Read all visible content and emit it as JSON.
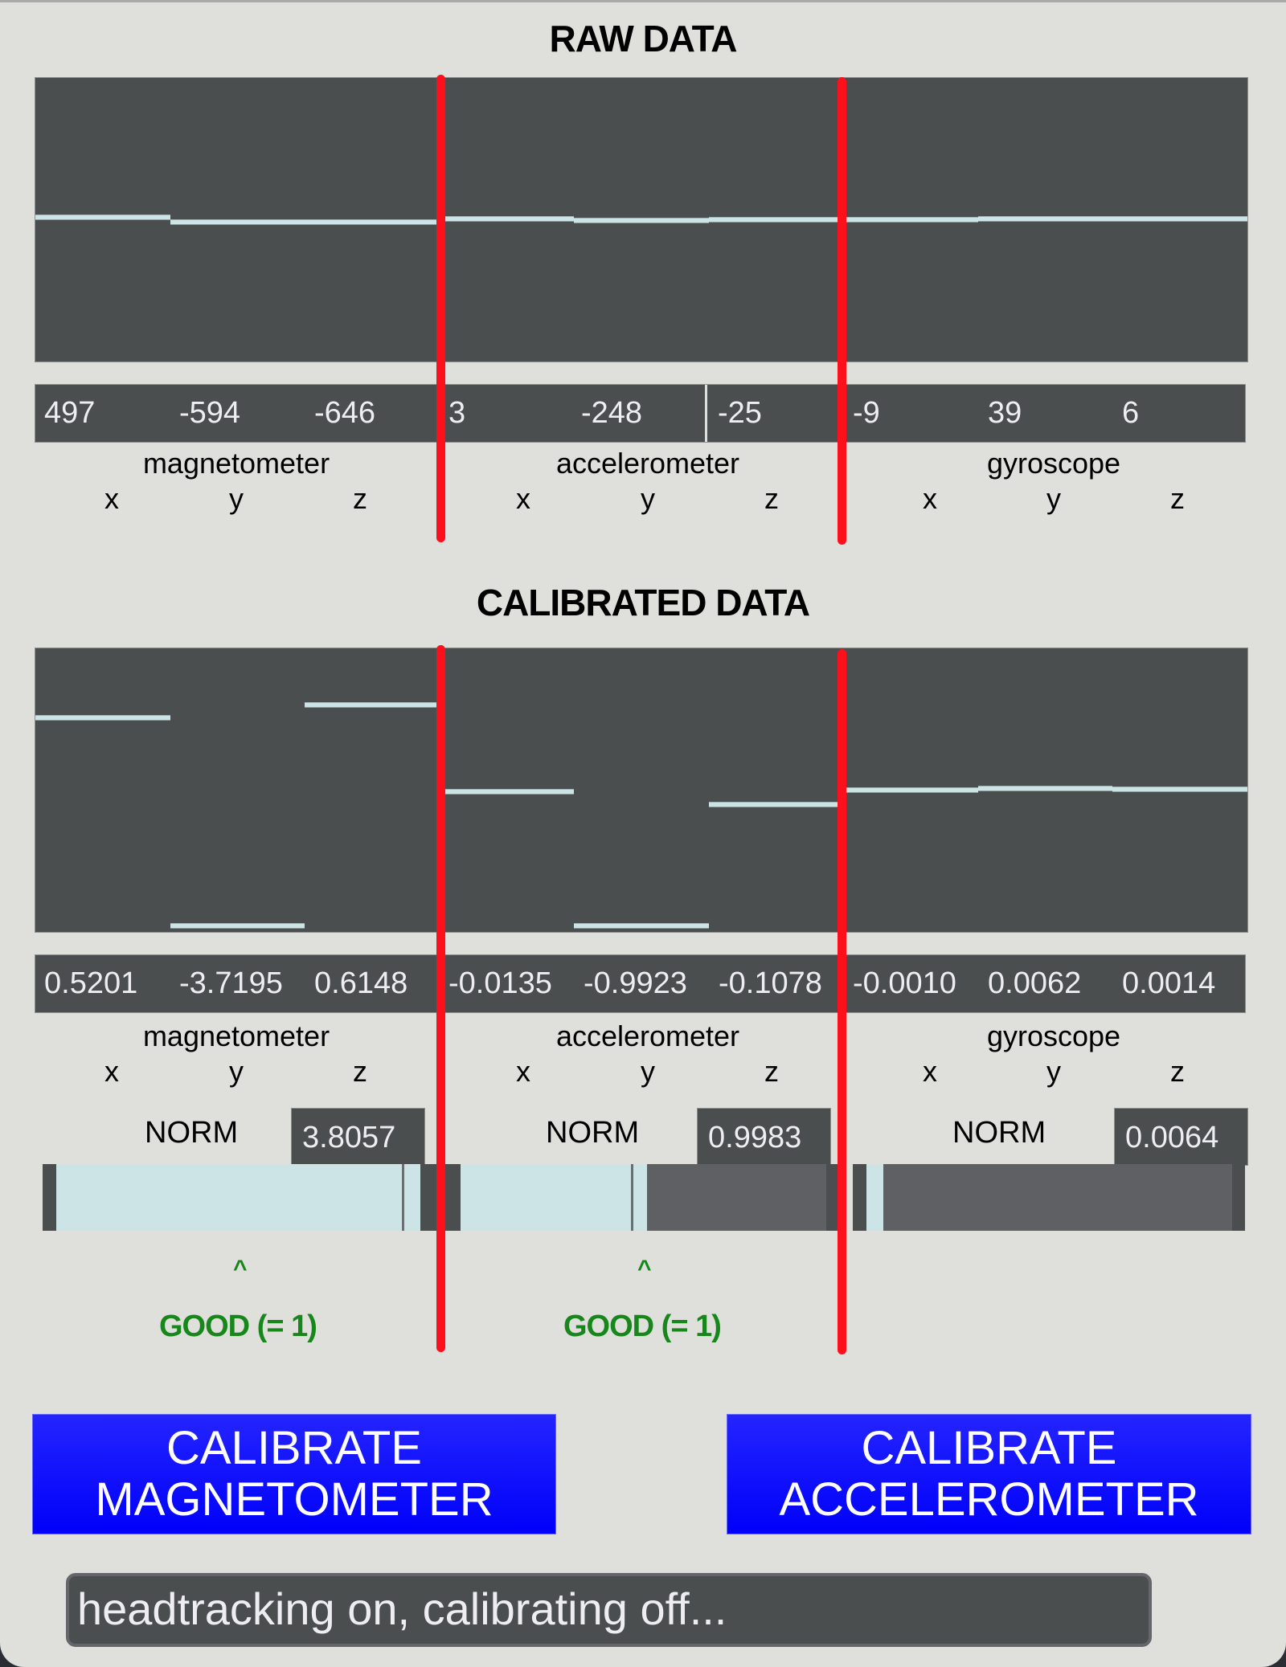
{
  "raw": {
    "title": "RAW DATA",
    "y_range": [
      -32768,
      32768
    ],
    "values": {
      "magnetometer": [
        "497",
        "-594",
        "-646"
      ],
      "accelerometer": [
        "3",
        "-248",
        "-25"
      ],
      "gyroscope": [
        "-9",
        "39",
        "6"
      ]
    },
    "plot_values": [
      497,
      -594,
      -646,
      3,
      -248,
      -25,
      -9,
      39,
      6
    ]
  },
  "calibrated": {
    "title": "CALIBRATED DATA",
    "y_range": [
      -1.03,
      1.03
    ],
    "values": {
      "magnetometer": [
        "0.5201",
        "-3.7195",
        "0.6148"
      ],
      "accelerometer": [
        "-0.0135",
        "-0.9923",
        "-0.1078"
      ],
      "gyroscope": [
        "-0.0010",
        "0.0062",
        "0.0014"
      ]
    },
    "plot_values": [
      0.5201,
      -3.7195,
      0.6148,
      -0.0135,
      -0.9923,
      -0.1078,
      -0.001,
      0.0062,
      0.0014
    ]
  },
  "groups": [
    {
      "name": "magnetometer",
      "axes": [
        "x",
        "y",
        "z"
      ]
    },
    {
      "name": "accelerometer",
      "axes": [
        "x",
        "y",
        "z"
      ]
    },
    {
      "name": "gyroscope",
      "axes": [
        "x",
        "y",
        "z"
      ]
    }
  ],
  "norms": [
    {
      "label": "NORM",
      "value": "3.8057",
      "meter_fill": 1.0,
      "target_tick": 0.95
    },
    {
      "label": "NORM",
      "value": "0.9983",
      "meter_fill": 0.51,
      "target_tick": 0.466
    },
    {
      "label": "NORM",
      "value": "0.0064",
      "meter_fill": 0.046,
      "target_tick": null
    }
  ],
  "indicators": [
    {
      "caret": "^",
      "text": "GOOD (= 1)"
    },
    {
      "caret": "^",
      "text": "GOOD (= 1)"
    }
  ],
  "buttons": {
    "calibrate_magnetometer": [
      "CALIBRATE",
      "MAGNETOMETER"
    ],
    "calibrate_accelerometer": [
      "CALIBRATE",
      "ACCELEROMETER"
    ]
  },
  "status": "headtracking on, calibrating off...",
  "colors": {
    "panel_bg": "#dfe0db",
    "plot_bg": "#4b4e4e",
    "trace": "#cde4e6",
    "divider_red": "#fc101c",
    "button_blue": "#0000fa",
    "good_green": "#18871b"
  }
}
